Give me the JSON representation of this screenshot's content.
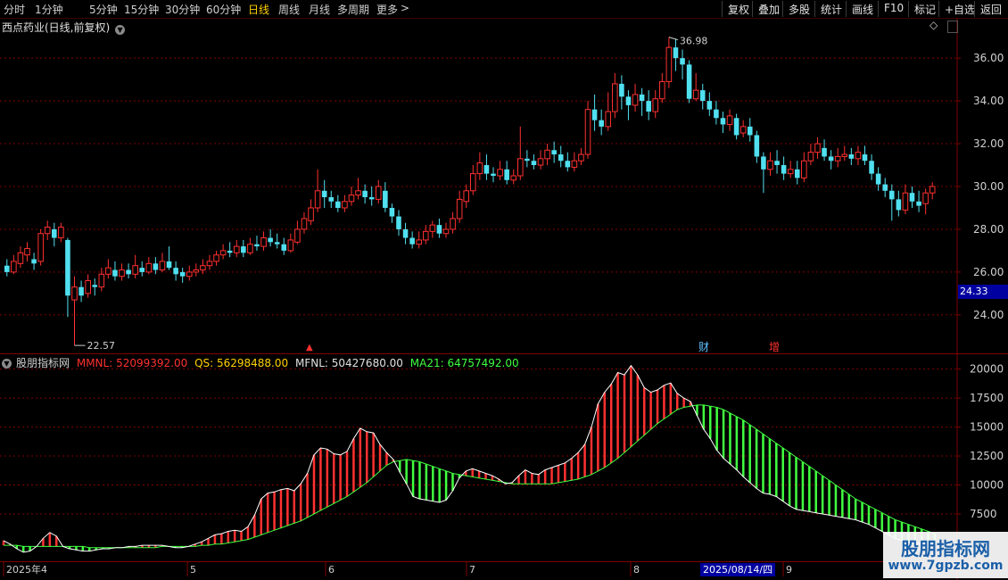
{
  "toolbar": {
    "periods": [
      "分时",
      "1分钟",
      "5分钟",
      "15分钟",
      "30分钟",
      "60分钟",
      "日线",
      "周线",
      "月线",
      "多周期",
      "更多"
    ],
    "active_period": "日线",
    "right_buttons": [
      "复权",
      "叠加",
      "多股",
      "统计",
      "画线",
      "F10",
      "标记",
      "+自选",
      "返回"
    ]
  },
  "price_panel": {
    "title": "西点药业(日线,前复权)",
    "current_price": "24.33",
    "max_label": "36.98",
    "min_label": "22.57",
    "markers": [
      "财",
      "增"
    ],
    "small_marker": "▲"
  },
  "indicator_panel": {
    "name": "股朋指标网",
    "values": [
      {
        "label": "MMNL: 52099392.00",
        "color": "#ff3030"
      },
      {
        "label": "QS: 56298488.00",
        "color": "#ffd000"
      },
      {
        "label": "MFNL: 50427680.00",
        "color": "#e0e0e0"
      },
      {
        "label": "MA21: 64757492.00",
        "color": "#40ff40"
      }
    ]
  },
  "x_axis": {
    "date_tag": "2025/08/14/四",
    "month_labels": [
      "2025年4",
      "5",
      "6",
      "7",
      "8",
      "9"
    ]
  },
  "watermark": {
    "title": "股朋指标网",
    "url": "www.7gpzb.com"
  },
  "colors": {
    "up": "#ff3030",
    "down": "#50e0f0",
    "grid": "#800000",
    "ma": "#40ff40",
    "line": "#ffffff"
  },
  "chart_data": [
    {
      "type": "candlestick",
      "y_ticks": [
        "36.00",
        "34.00",
        "32.00",
        "30.00",
        "28.00",
        "26.00",
        "24.00"
      ],
      "ylim": [
        22.2,
        37.8
      ],
      "candles": [
        [
          26.3,
          26.0,
          26.6,
          25.8
        ],
        [
          26.0,
          26.5,
          26.8,
          25.9
        ],
        [
          26.4,
          26.9,
          27.2,
          26.2
        ],
        [
          26.8,
          27.1,
          27.4,
          26.5
        ],
        [
          26.6,
          26.4,
          26.9,
          26.1
        ],
        [
          26.5,
          27.8,
          28.0,
          26.3
        ],
        [
          27.8,
          28.1,
          28.4,
          27.5
        ],
        [
          28.0,
          27.6,
          28.3,
          27.2
        ],
        [
          27.6,
          28.1,
          28.3,
          27.4
        ],
        [
          27.5,
          24.9,
          27.6,
          23.9
        ],
        [
          24.7,
          25.3,
          25.8,
          22.57
        ],
        [
          25.3,
          24.9,
          25.6,
          24.6
        ],
        [
          25.0,
          25.6,
          25.9,
          24.8
        ],
        [
          25.4,
          25.3,
          25.7,
          24.9
        ],
        [
          25.3,
          25.9,
          26.2,
          25.1
        ],
        [
          25.9,
          26.2,
          26.6,
          25.7
        ],
        [
          26.1,
          25.8,
          26.5,
          25.6
        ],
        [
          25.8,
          26.1,
          26.4,
          25.6
        ],
        [
          26.1,
          25.9,
          26.4,
          25.7
        ],
        [
          25.9,
          26.3,
          26.8,
          25.7
        ],
        [
          26.2,
          26.0,
          26.5,
          25.8
        ],
        [
          26.0,
          26.4,
          26.7,
          25.9
        ],
        [
          26.4,
          26.1,
          26.7,
          25.9
        ],
        [
          26.1,
          26.5,
          26.9,
          26.0
        ],
        [
          26.5,
          26.2,
          27.2,
          26.1
        ],
        [
          26.2,
          25.9,
          26.5,
          25.6
        ],
        [
          26.0,
          25.8,
          26.2,
          25.5
        ],
        [
          25.8,
          26.0,
          26.3,
          25.6
        ],
        [
          26.0,
          26.1,
          26.4,
          25.8
        ],
        [
          26.1,
          26.3,
          26.6,
          25.9
        ],
        [
          26.3,
          26.5,
          26.8,
          26.1
        ],
        [
          26.5,
          26.8,
          27.0,
          26.3
        ],
        [
          26.8,
          27.0,
          27.3,
          26.6
        ],
        [
          27.0,
          26.9,
          27.4,
          26.7
        ],
        [
          26.9,
          27.2,
          27.5,
          26.7
        ],
        [
          27.2,
          26.9,
          27.5,
          26.7
        ],
        [
          26.9,
          27.3,
          27.6,
          26.8
        ],
        [
          27.3,
          27.2,
          27.7,
          27.0
        ],
        [
          27.2,
          27.6,
          27.9,
          27.0
        ],
        [
          27.6,
          27.4,
          28.0,
          27.2
        ],
        [
          27.4,
          27.3,
          27.8,
          27.1
        ],
        [
          27.3,
          27.0,
          27.6,
          26.8
        ],
        [
          27.0,
          27.5,
          27.8,
          26.9
        ],
        [
          27.4,
          28.0,
          28.4,
          27.3
        ],
        [
          28.0,
          28.5,
          28.8,
          27.8
        ],
        [
          28.4,
          29.0,
          29.4,
          28.2
        ],
        [
          29.0,
          29.8,
          30.8,
          28.8
        ],
        [
          29.8,
          29.5,
          30.3,
          29.0
        ],
        [
          29.5,
          29.3,
          29.8,
          29.0
        ],
        [
          29.3,
          29.0,
          29.6,
          28.8
        ],
        [
          29.0,
          29.3,
          29.6,
          28.8
        ],
        [
          29.3,
          29.6,
          30.0,
          29.1
        ],
        [
          29.6,
          29.8,
          30.4,
          29.4
        ],
        [
          29.8,
          29.5,
          30.1,
          29.2
        ],
        [
          29.5,
          29.4,
          30.0,
          29.1
        ],
        [
          29.4,
          30.0,
          30.3,
          29.2
        ],
        [
          29.8,
          29.0,
          30.2,
          28.8
        ],
        [
          29.0,
          28.6,
          29.2,
          28.3
        ],
        [
          28.6,
          28.0,
          28.9,
          27.7
        ],
        [
          28.0,
          27.6,
          28.3,
          27.3
        ],
        [
          27.6,
          27.3,
          27.9,
          27.1
        ],
        [
          27.3,
          27.5,
          27.9,
          27.1
        ],
        [
          27.5,
          27.9,
          28.2,
          27.3
        ],
        [
          27.9,
          28.2,
          28.4,
          27.6
        ],
        [
          28.2,
          27.8,
          28.5,
          27.6
        ],
        [
          27.8,
          28.0,
          28.3,
          27.6
        ],
        [
          28.0,
          28.5,
          28.8,
          27.8
        ],
        [
          28.5,
          29.4,
          29.8,
          28.3
        ],
        [
          29.3,
          29.8,
          30.1,
          29.0
        ],
        [
          29.8,
          30.6,
          31.0,
          29.6
        ],
        [
          30.6,
          31.1,
          31.6,
          30.3
        ],
        [
          31.0,
          30.6,
          31.5,
          30.3
        ],
        [
          30.6,
          30.5,
          30.9,
          30.2
        ],
        [
          30.5,
          30.8,
          31.2,
          30.3
        ],
        [
          30.8,
          30.3,
          31.2,
          30.1
        ],
        [
          30.3,
          30.5,
          30.8,
          30.1
        ],
        [
          30.5,
          31.3,
          32.8,
          30.3
        ],
        [
          31.3,
          31.2,
          31.7,
          30.9
        ],
        [
          31.2,
          31.0,
          31.5,
          30.8
        ],
        [
          31.0,
          31.3,
          31.7,
          30.8
        ],
        [
          31.3,
          31.7,
          32.0,
          31.0
        ],
        [
          31.7,
          31.5,
          32.1,
          31.1
        ],
        [
          31.5,
          31.2,
          31.9,
          30.9
        ],
        [
          31.2,
          30.9,
          31.6,
          30.7
        ],
        [
          30.9,
          31.2,
          31.6,
          30.7
        ],
        [
          31.2,
          31.5,
          31.8,
          31.0
        ],
        [
          31.5,
          33.6,
          34.0,
          31.3
        ],
        [
          33.6,
          33.1,
          34.3,
          32.6
        ],
        [
          33.1,
          32.8,
          33.6,
          32.4
        ],
        [
          32.8,
          33.5,
          34.4,
          32.6
        ],
        [
          33.5,
          34.8,
          35.3,
          33.2
        ],
        [
          34.8,
          34.2,
          35.2,
          33.6
        ],
        [
          34.2,
          33.8,
          34.5,
          33.1
        ],
        [
          33.8,
          34.3,
          34.8,
          33.5
        ],
        [
          34.3,
          34.0,
          34.6,
          33.3
        ],
        [
          34.0,
          33.5,
          34.5,
          33.1
        ],
        [
          33.5,
          34.1,
          34.5,
          33.2
        ],
        [
          34.1,
          34.9,
          35.3,
          33.9
        ],
        [
          34.9,
          36.5,
          36.98,
          34.6
        ],
        [
          36.5,
          36.0,
          36.9,
          35.4
        ],
        [
          36.0,
          35.7,
          36.4,
          35.0
        ],
        [
          35.7,
          34.1,
          35.9,
          33.9
        ],
        [
          34.1,
          34.5,
          35.3,
          34.0
        ],
        [
          34.5,
          34.0,
          34.8,
          33.6
        ],
        [
          34.0,
          33.6,
          34.4,
          33.3
        ],
        [
          33.6,
          33.2,
          34.0,
          32.9
        ],
        [
          33.2,
          32.9,
          33.5,
          32.5
        ],
        [
          32.9,
          33.3,
          33.6,
          32.6
        ],
        [
          33.2,
          32.4,
          33.4,
          32.2
        ],
        [
          32.5,
          32.8,
          33.1,
          32.3
        ],
        [
          32.8,
          32.4,
          33.2,
          32.1
        ],
        [
          32.4,
          31.4,
          32.6,
          31.1
        ],
        [
          31.4,
          30.8,
          31.6,
          29.7
        ],
        [
          30.8,
          31.2,
          31.6,
          30.5
        ],
        [
          31.2,
          31.0,
          31.7,
          30.6
        ],
        [
          31.0,
          30.6,
          31.4,
          30.3
        ],
        [
          30.6,
          30.8,
          31.2,
          30.4
        ],
        [
          30.8,
          30.4,
          31.2,
          30.1
        ],
        [
          30.4,
          31.2,
          31.6,
          30.2
        ],
        [
          31.2,
          31.6,
          32.0,
          31.0
        ],
        [
          31.6,
          32.0,
          32.3,
          31.3
        ],
        [
          31.8,
          31.4,
          32.2,
          31.2
        ],
        [
          31.4,
          31.2,
          31.7,
          30.8
        ],
        [
          31.2,
          31.4,
          31.8,
          30.9
        ],
        [
          31.4,
          31.5,
          31.9,
          31.2
        ],
        [
          31.5,
          31.3,
          31.8,
          31.0
        ],
        [
          31.3,
          31.6,
          31.9,
          31.0
        ],
        [
          31.5,
          31.2,
          31.9,
          31.0
        ],
        [
          31.2,
          30.6,
          31.5,
          30.3
        ],
        [
          30.6,
          30.1,
          30.9,
          29.8
        ],
        [
          30.1,
          29.8,
          30.4,
          29.5
        ],
        [
          29.8,
          29.4,
          30.1,
          28.4
        ],
        [
          29.4,
          28.9,
          29.8,
          28.6
        ],
        [
          28.9,
          29.7,
          30.1,
          28.7
        ],
        [
          29.7,
          29.3,
          30.0,
          29.0
        ],
        [
          29.3,
          29.1,
          29.8,
          28.8
        ],
        [
          29.2,
          29.7,
          29.9,
          28.7
        ],
        [
          29.7,
          30.0,
          30.2,
          29.4
        ]
      ]
    },
    {
      "type": "indicator",
      "y_ticks": [
        "20000",
        "17500",
        "15000",
        "12500",
        "10000",
        "7500"
      ],
      "ylim": [
        3500,
        21200
      ],
      "series": [
        {
          "name": "MMNL",
          "values": [
            5200,
            4900,
            4500,
            4200,
            4300,
            4700,
            5400,
            5900,
            5600,
            4700,
            4500,
            4400,
            4300,
            4300,
            4400,
            4500,
            4500,
            4600,
            4600,
            4700,
            4700,
            4800,
            4800,
            4800,
            4800,
            4700,
            4600,
            4600,
            4700,
            4900,
            5100,
            5400,
            5700,
            5800,
            6000,
            6100,
            6000,
            6400,
            7400,
            8800,
            9300,
            9400,
            9600,
            9700,
            9500,
            10100,
            11000,
            12600,
            13200,
            13100,
            12700,
            12600,
            12900,
            14000,
            14900,
            14600,
            14500,
            13500,
            12800,
            12200,
            11100,
            10100,
            9000,
            8800,
            8700,
            8600,
            8500,
            8700,
            9500,
            10600,
            11200,
            11400,
            11200,
            11000,
            10800,
            10500,
            10100,
            10200,
            10800,
            11300,
            11000,
            10900,
            11300,
            11500,
            11700,
            11900,
            12300,
            12800,
            13500,
            15000,
            17000,
            18000,
            18700,
            19700,
            19500,
            20300,
            19500,
            18400,
            18000,
            18200,
            18600,
            18800,
            17900,
            17500,
            17200,
            16000,
            14800,
            14000,
            13000,
            12300,
            11800,
            11300,
            10700,
            10200,
            9700,
            9300,
            9200,
            9000,
            8600,
            8200,
            7900,
            7800,
            7700,
            7600,
            7500,
            7400,
            7300,
            7200,
            7100,
            7000,
            6800,
            6600,
            6300,
            6000,
            5700,
            5400,
            5200,
            5100,
            5000,
            4900,
            4900,
            4900
          ]
        },
        {
          "name": "MA21",
          "values": [
            4800,
            4800,
            4800,
            4700,
            4700,
            4700,
            4700,
            4700,
            4700,
            4700,
            4700,
            4700,
            4700,
            4600,
            4600,
            4600,
            4600,
            4600,
            4600,
            4600,
            4600,
            4600,
            4600,
            4600,
            4700,
            4700,
            4700,
            4700,
            4700,
            4700,
            4800,
            4800,
            4900,
            4900,
            5000,
            5100,
            5200,
            5300,
            5500,
            5700,
            5900,
            6100,
            6300,
            6500,
            6700,
            6900,
            7200,
            7500,
            7800,
            8100,
            8400,
            8700,
            9000,
            9400,
            9800,
            10200,
            10700,
            11200,
            11700,
            12000,
            12100,
            12200,
            12100,
            12000,
            11800,
            11600,
            11400,
            11200,
            11000,
            10900,
            10800,
            10700,
            10600,
            10500,
            10400,
            10300,
            10200,
            10100,
            10100,
            10100,
            10100,
            10100,
            10100,
            10100,
            10200,
            10300,
            10400,
            10500,
            10700,
            10900,
            11200,
            11500,
            11900,
            12300,
            12800,
            13300,
            13800,
            14300,
            14800,
            15300,
            15700,
            16100,
            16500,
            16700,
            16800,
            16900,
            16900,
            16800,
            16700,
            16500,
            16200,
            15900,
            15600,
            15200,
            14800,
            14400,
            14000,
            13600,
            13200,
            12800,
            12400,
            12000,
            11600,
            11200,
            10800,
            10400,
            10000,
            9600,
            9200,
            8800,
            8500,
            8200,
            7900,
            7600,
            7300,
            7000,
            6800,
            6600,
            6400,
            6200,
            6000,
            5800
          ]
        }
      ]
    }
  ]
}
